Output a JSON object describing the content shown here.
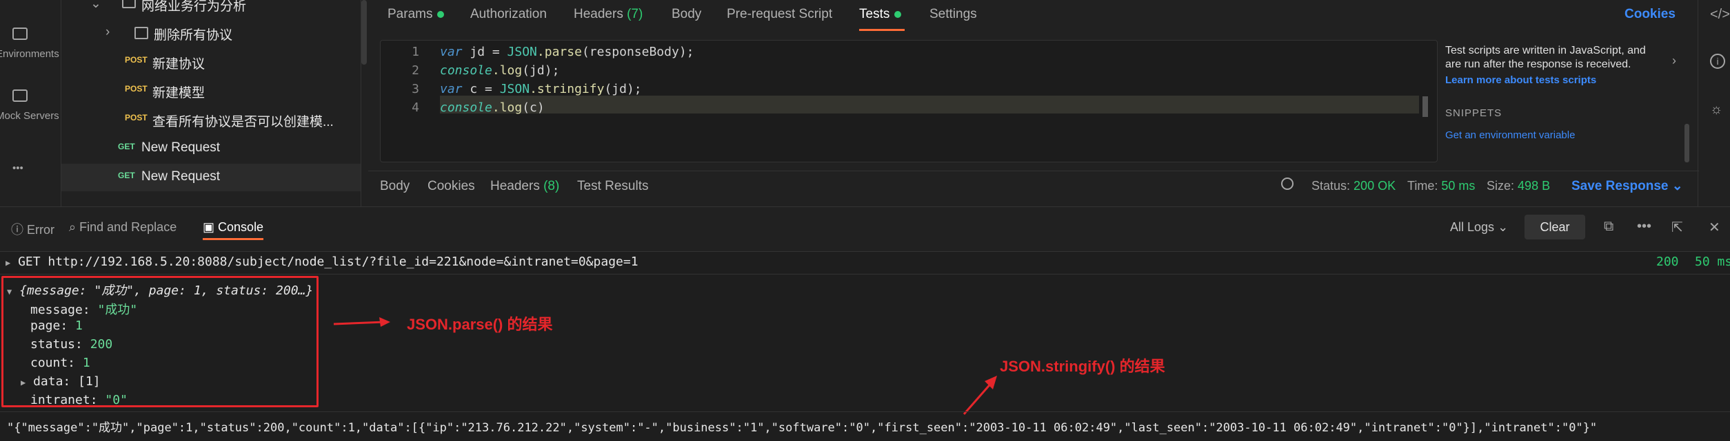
{
  "rail": {
    "items": [
      {
        "label": "Environments",
        "icon": "environment-icon"
      },
      {
        "label": "Mock Servers",
        "icon": "server-icon"
      },
      {
        "label": "•••",
        "icon": "more-icon"
      }
    ]
  },
  "tree": {
    "folder_top": "网络业务行为分析",
    "folder_delete": "删除所有协议",
    "requests": [
      {
        "method": "POST",
        "name": "新建协议"
      },
      {
        "method": "POST",
        "name": "新建模型"
      },
      {
        "method": "POST",
        "name": "查看所有协议是否可以创建模..."
      },
      {
        "method": "GET",
        "name": "New Request"
      },
      {
        "method": "GET",
        "name": "New Request"
      }
    ]
  },
  "request_tabs": {
    "params": "Params",
    "authorization": "Authorization",
    "headers": "Headers",
    "headers_count": "(7)",
    "body": "Body",
    "prerequest": "Pre-request Script",
    "tests": "Tests",
    "settings": "Settings",
    "cookies": "Cookies"
  },
  "editor": {
    "line_numbers": [
      "1",
      "2",
      "3",
      "4"
    ],
    "l1_kw": "var",
    "l1_a": " jd = ",
    "l1_obj": "JSON",
    "l1_fn": ".parse",
    "l1_b": "(responseBody);",
    "l2_obj": "console",
    "l2_fn": ".log",
    "l2_b": "(jd);",
    "l3_kw": "var",
    "l3_a": " c = ",
    "l3_obj": "JSON",
    "l3_fn": ".stringify",
    "l3_b": "(jd);",
    "l4_obj": "console",
    "l4_fn": ".log",
    "l4_b": "(c)"
  },
  "snippets": {
    "description": "Test scripts are written in JavaScript, and are run after the response is received.",
    "learn_more": "Learn more about tests scripts",
    "title": "SNIPPETS",
    "env_var": "Get an environment variable"
  },
  "response": {
    "tabs": [
      "Body",
      "Cookies",
      "Headers",
      "Test Results"
    ],
    "headers_count": "(8)",
    "status_label": "Status:",
    "status_value": "200 OK",
    "time_label": "Time:",
    "time_value": "50 ms",
    "size_label": "Size:",
    "size_value": "498 B",
    "save": "Save Response"
  },
  "console": {
    "error": "Error",
    "find_replace": "Find and Replace",
    "console": "Console",
    "all_logs": "All Logs",
    "clear": "Clear",
    "request_line": "GET http://192.168.5.20:8088/subject/node_list/?file_id=221&node=&intranet=0&page=1",
    "req_status": "200",
    "req_time": "50 ms",
    "object_summary": "{message: \"成功\", page: 1, status: 200…}",
    "fields": [
      {
        "key": "message:",
        "value": "\"成功\""
      },
      {
        "key": "page:",
        "value": "1"
      },
      {
        "key": "status:",
        "value": "200"
      },
      {
        "key": "count:",
        "value": "1"
      },
      {
        "key": "data:",
        "value": "[1]"
      },
      {
        "key": "intranet:",
        "value": "\"0\""
      }
    ],
    "stringified": "\"{\"message\":\"成功\",\"page\":1,\"status\":200,\"count\":1,\"data\":[{\"ip\":\"213.76.212.22\",\"system\":\"-\",\"business\":\"1\",\"software\":\"0\",\"first_seen\":\"2003-10-11 06:02:49\",\"last_seen\":\"2003-10-11 06:02:49\",\"intranet\":\"0\"}],\"intranet\":\"0\"}\""
  },
  "annotations": {
    "parse": "JSON.parse() 的结果",
    "stringify": "JSON.stringify() 的结果",
    "color": "#e5262b"
  }
}
